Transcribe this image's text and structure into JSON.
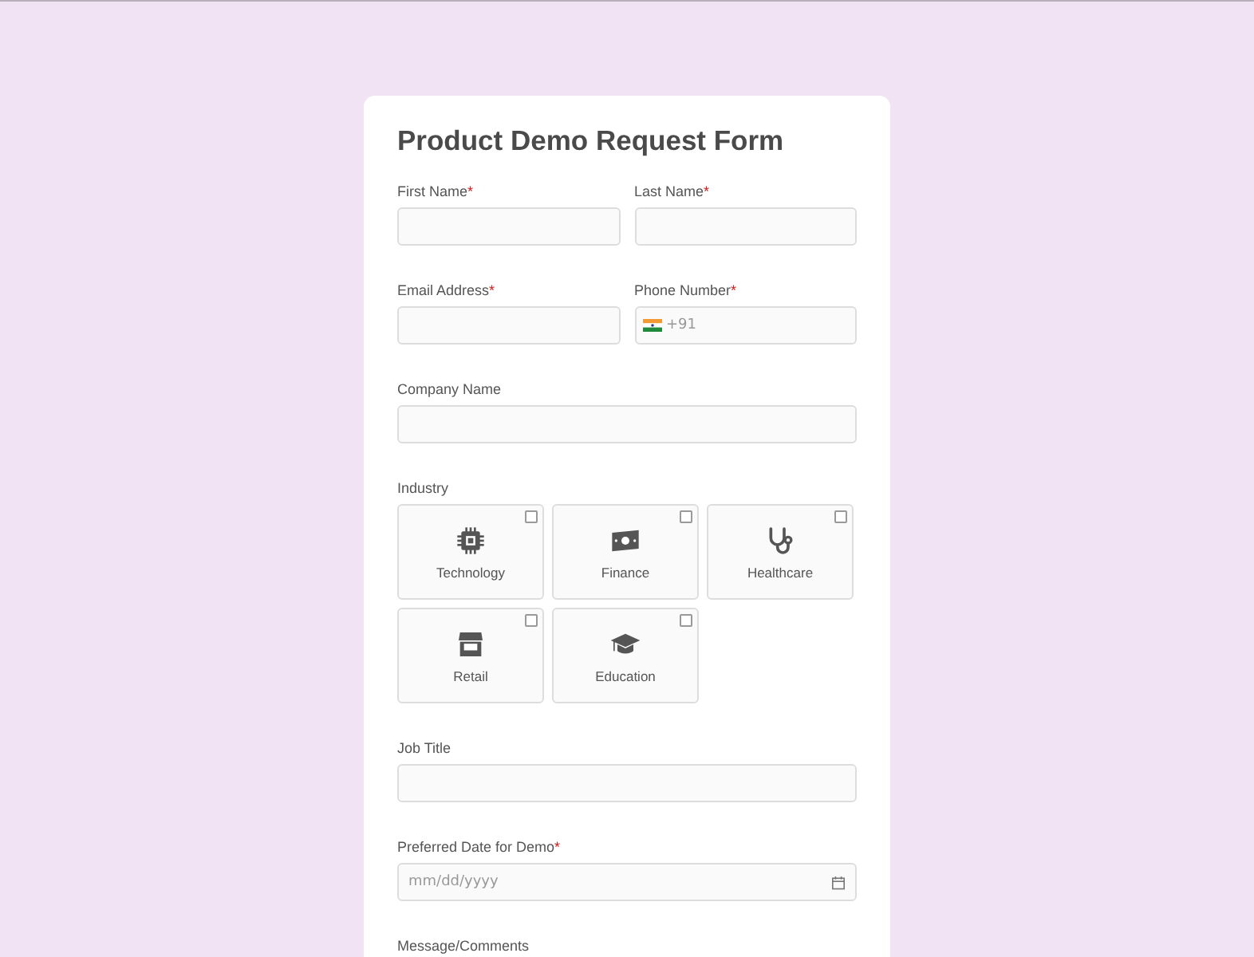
{
  "form": {
    "title": "Product Demo Request Form",
    "rows": [
      [
        {
          "kind": "text",
          "label": "First Name",
          "mark": "*"
        },
        {
          "kind": "text",
          "label": "Last Name",
          "mark": "*"
        }
      ],
      [
        {
          "kind": "text",
          "label": "Email Address",
          "mark": "*"
        },
        {
          "kind": "phone",
          "label": "Phone Number",
          "mark": "*",
          "placeholder": "+91"
        }
      ],
      [
        {
          "kind": "text",
          "label": "Company Name"
        }
      ],
      [
        {
          "kind": "tiles",
          "label": "Industry",
          "options": [
            {
              "label": "Technology",
              "checked": false
            },
            {
              "label": "Finance",
              "checked": false
            },
            {
              "label": "Healthcare",
              "checked": false
            },
            {
              "label": "Retail",
              "checked": false
            },
            {
              "label": "Education",
              "checked": false
            }
          ]
        }
      ],
      [
        {
          "kind": "text",
          "label": "Job Title"
        }
      ],
      [
        {
          "kind": "date",
          "label": "Preferred Date for Demo",
          "mark": "*",
          "placeholder": "mm/dd/yyyy"
        }
      ],
      [
        {
          "kind": "textarea",
          "label": "Message/Comments"
        }
      ]
    ]
  }
}
